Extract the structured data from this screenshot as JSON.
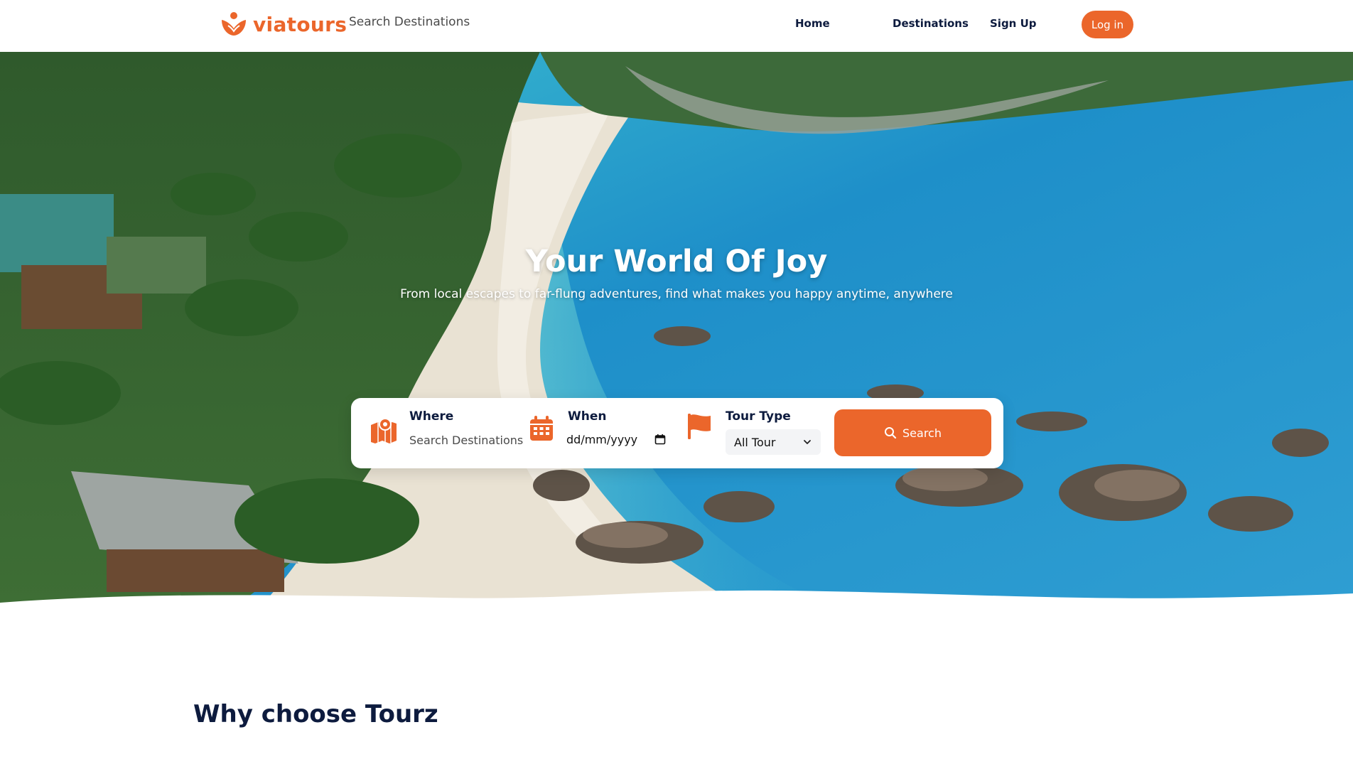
{
  "brand": {
    "name": "viatours",
    "color": "#eb662b"
  },
  "header": {
    "search_placeholder": "Search Destinations",
    "nav": {
      "home": "Home",
      "destinations": "Destinations",
      "signup": "Sign Up"
    },
    "login_label": "Log in"
  },
  "hero": {
    "title": "Your World Of Joy",
    "subtitle": "From local escapes to far-flung adventures, find what makes you happy anytime, anywhere"
  },
  "search_panel": {
    "where": {
      "label": "Where",
      "placeholder": "Search Destinations",
      "icon": "map-pin-icon"
    },
    "when": {
      "label": "When",
      "value": "dd/mm/yyyy",
      "icon": "calendar-icon"
    },
    "tour_type": {
      "label": "Tour Type",
      "selected": "All Tour",
      "icon": "flag-icon"
    },
    "search_button": {
      "label": "Search",
      "icon": "search-icon"
    }
  },
  "section": {
    "title": "Why choose Tourz"
  }
}
